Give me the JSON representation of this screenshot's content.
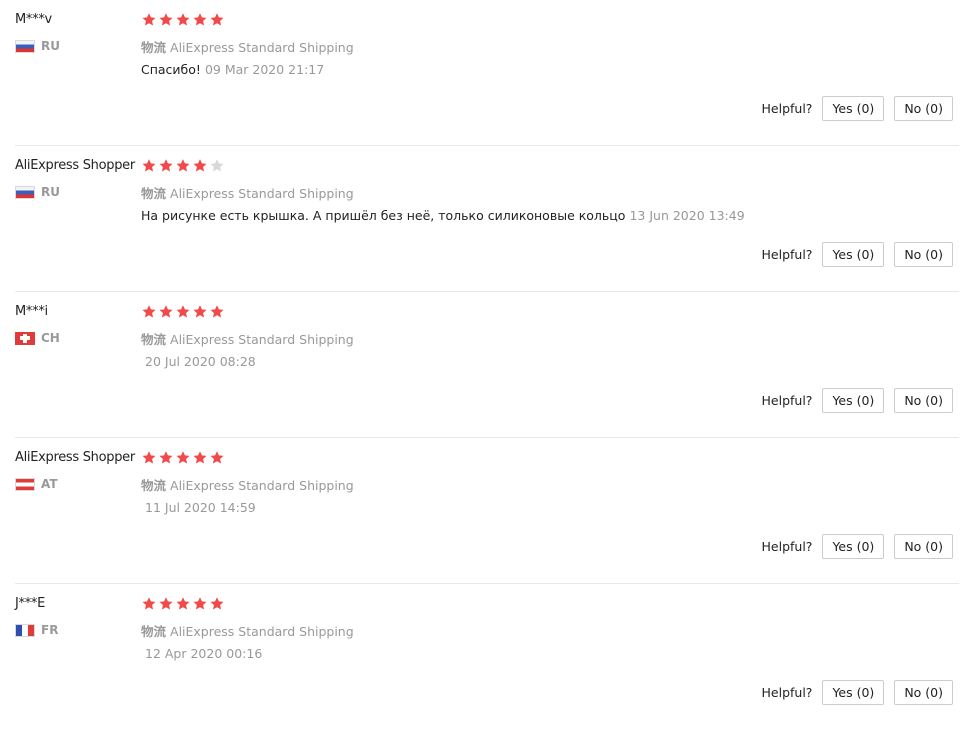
{
  "colors": {
    "star_filled": "#f04b4b",
    "star_empty": "#d8d8d8",
    "muted_text": "#999999"
  },
  "reviews": [
    {
      "user": "M***v",
      "country": "RU",
      "flag": "ru",
      "rating": 5,
      "shipping_label": "物流",
      "shipping_value": "AliExpress Standard Shipping",
      "text": "Спасибо!",
      "date": "09 Mar 2020 21:17",
      "helpful_label": "Helpful?",
      "yes_label": "Yes (0)",
      "no_label": "No (0)"
    },
    {
      "user": "AliExpress Shopper",
      "country": "RU",
      "flag": "ru",
      "rating": 4,
      "shipping_label": "物流",
      "shipping_value": "AliExpress Standard Shipping",
      "text": "На рисунке есть крышка. А пришёл без неё, только силиконовые кольцо",
      "date": "13 Jun 2020 13:49",
      "helpful_label": "Helpful?",
      "yes_label": "Yes (0)",
      "no_label": "No (0)"
    },
    {
      "user": "M***i",
      "country": "CH",
      "flag": "ch",
      "rating": 5,
      "shipping_label": "物流",
      "shipping_value": "AliExpress Standard Shipping",
      "text": "",
      "date": "20 Jul 2020 08:28",
      "helpful_label": "Helpful?",
      "yes_label": "Yes (0)",
      "no_label": "No (0)"
    },
    {
      "user": "AliExpress Shopper",
      "country": "AT",
      "flag": "at",
      "rating": 5,
      "shipping_label": "物流",
      "shipping_value": "AliExpress Standard Shipping",
      "text": "",
      "date": "11 Jul 2020 14:59",
      "helpful_label": "Helpful?",
      "yes_label": "Yes (0)",
      "no_label": "No (0)"
    },
    {
      "user": "J***E",
      "country": "FR",
      "flag": "fr",
      "rating": 5,
      "shipping_label": "物流",
      "shipping_value": "AliExpress Standard Shipping",
      "text": "",
      "date": "12 Apr 2020 00:16",
      "helpful_label": "Helpful?",
      "yes_label": "Yes (0)",
      "no_label": "No (0)"
    }
  ]
}
